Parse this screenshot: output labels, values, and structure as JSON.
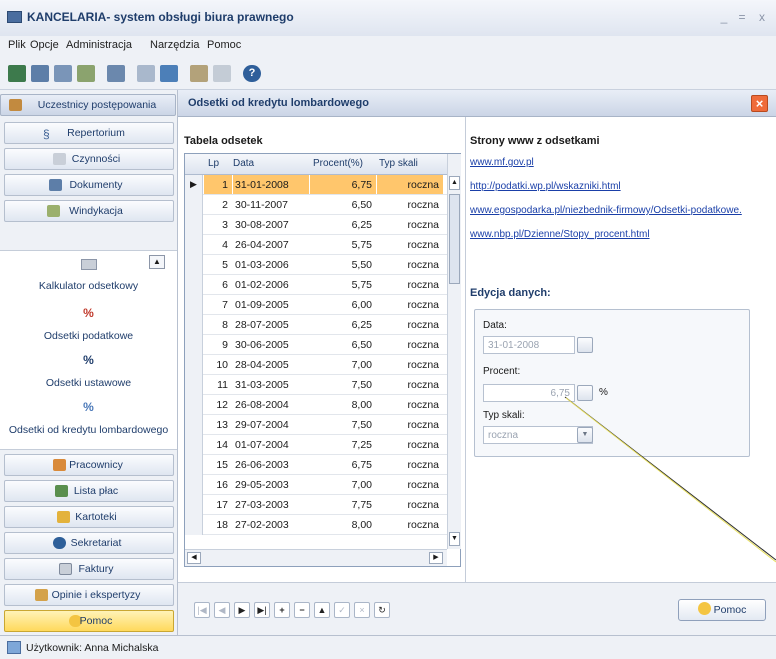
{
  "window": {
    "title": "KANCELARIA- system obsługi biura prawnego",
    "min": "_",
    "max": "=",
    "close": "x"
  },
  "menu": [
    "Plik",
    "Opcje",
    "Administracja",
    "Narzędzia",
    "Pomoc"
  ],
  "sidebar": {
    "top_items": [
      "Uczestnicy postępowania",
      "Repertorium",
      "Czynności",
      "Dokumenty",
      "Windykacja"
    ],
    "calc_items": [
      "Kalkulator odsetkowy",
      "Odsetki podatkowe",
      "Odsetki ustawowe",
      "Odsetki od kredytu lombardowego"
    ],
    "bottom_items": [
      "Pracownicy",
      "Lista płac",
      "Kartoteki",
      "Sekretariat",
      "Faktury",
      "Opinie i ekspertyzy",
      "Pomoc"
    ]
  },
  "main": {
    "title": "Odsetki od kredytu lombardowego",
    "table_title": "Tabela odsetek",
    "columns": [
      "Lp",
      "Data",
      "Procent(%)",
      "Typ skali"
    ],
    "rows": [
      [
        "1",
        "31-01-2008",
        "6,75",
        "roczna"
      ],
      [
        "2",
        "30-11-2007",
        "6,50",
        "roczna"
      ],
      [
        "3",
        "30-08-2007",
        "6,25",
        "roczna"
      ],
      [
        "4",
        "26-04-2007",
        "5,75",
        "roczna"
      ],
      [
        "5",
        "01-03-2006",
        "5,50",
        "roczna"
      ],
      [
        "6",
        "01-02-2006",
        "5,75",
        "roczna"
      ],
      [
        "7",
        "01-09-2005",
        "6,00",
        "roczna"
      ],
      [
        "8",
        "28-07-2005",
        "6,25",
        "roczna"
      ],
      [
        "9",
        "30-06-2005",
        "6,50",
        "roczna"
      ],
      [
        "10",
        "28-04-2005",
        "7,00",
        "roczna"
      ],
      [
        "11",
        "31-03-2005",
        "7,50",
        "roczna"
      ],
      [
        "12",
        "26-08-2004",
        "8,00",
        "roczna"
      ],
      [
        "13",
        "29-07-2004",
        "7,50",
        "roczna"
      ],
      [
        "14",
        "01-07-2004",
        "7,25",
        "roczna"
      ],
      [
        "15",
        "26-06-2003",
        "6,75",
        "roczna"
      ],
      [
        "16",
        "29-05-2003",
        "7,00",
        "roczna"
      ],
      [
        "17",
        "27-03-2003",
        "7,75",
        "roczna"
      ],
      [
        "18",
        "27-02-2003",
        "8,00",
        "roczna"
      ]
    ],
    "links_title": "Strony www z odsetkami",
    "links": [
      "www.mf.gov.pl",
      "http://podatki.wp.pl/wskazniki.html",
      "www.egospodarka.pl/niezbednik-firmowy/Odsetki-podatkowe.",
      "www.nbp.pl/Dzienne/Stopy_procent.html"
    ],
    "edit_title": "Edycja danych:",
    "fields": {
      "data_label": "Data:",
      "data_value": "31-01-2008",
      "procent_label": "Procent:",
      "procent_value": "6,75",
      "procent_unit": "%",
      "typ_label": "Typ skali:",
      "typ_value": "roczna"
    },
    "help_button": "Pomoc"
  },
  "status": {
    "user": "Użytkownik: Anna Michalska"
  }
}
